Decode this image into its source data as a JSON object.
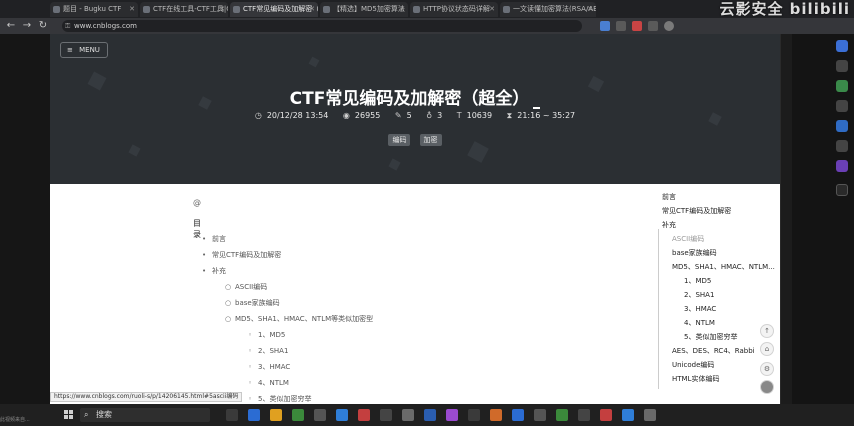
{
  "browser": {
    "tabs": [
      {
        "label": "题目 - Bugku CTF",
        "active": false
      },
      {
        "label": "CTF在线工具-CTF工具|CTF",
        "active": false
      },
      {
        "label": "CTF常见编码及加解密（超全",
        "active": true
      },
      {
        "label": "【精选】MD5加密算法",
        "active": false
      },
      {
        "label": "HTTP协议状态码详解",
        "active": false
      },
      {
        "label": "一文读懂加密算法(RSA/AES",
        "active": false
      }
    ],
    "url": "www.cnblogs.com",
    "watermark": "云影安全 bilibili"
  },
  "banner": {
    "menu_label": "MENU",
    "title": "CTF常见编码及加解密（超全）",
    "meta": {
      "date": "20/12/28 13:54",
      "views": "26955",
      "comments": "5",
      "likes": "3",
      "words": "10639",
      "read_time": "21:16 ~ 35:27"
    },
    "tags": [
      "编码",
      "加密"
    ]
  },
  "article_toc": {
    "hash_glyph": "@",
    "heading": "目录",
    "items": [
      {
        "level": 1,
        "bullet": "•",
        "label": "前言"
      },
      {
        "level": 1,
        "bullet": "•",
        "label": "常见CTF编码及加解密"
      },
      {
        "level": 1,
        "bullet": "•",
        "label": "补充"
      },
      {
        "level": 2,
        "bullet": "○",
        "label": "ASCII编码"
      },
      {
        "level": 2,
        "bullet": "○",
        "label": "base家族编码"
      },
      {
        "level": 2,
        "bullet": "○",
        "label": "MD5、SHA1、HMAC、NTLM等类似加密型"
      },
      {
        "level": 3,
        "bullet": "◦",
        "label": "1、MD5"
      },
      {
        "level": 3,
        "bullet": "◦",
        "label": "2、SHA1"
      },
      {
        "level": 3,
        "bullet": "◦",
        "label": "3、HMAC"
      },
      {
        "level": 3,
        "bullet": "◦",
        "label": "4、NTLM"
      },
      {
        "level": 3,
        "bullet": "◦",
        "label": "5、类似加密穷举"
      }
    ]
  },
  "side_toc": {
    "items": [
      {
        "label": "前言",
        "indent": 0,
        "muted": false
      },
      {
        "label": "常见CTF编码及加解密",
        "indent": 0,
        "muted": false
      },
      {
        "label": "补充",
        "indent": 0,
        "muted": false
      },
      {
        "label": "ASCII编码",
        "indent": 1,
        "muted": true
      },
      {
        "label": "base家族编码",
        "indent": 1,
        "muted": false
      },
      {
        "label": "MD5、SHA1、HMAC、NTLM...",
        "indent": 1,
        "muted": false
      },
      {
        "label": "1、MD5",
        "indent": 2,
        "muted": false
      },
      {
        "label": "2、SHA1",
        "indent": 2,
        "muted": false
      },
      {
        "label": "3、HMAC",
        "indent": 2,
        "muted": false
      },
      {
        "label": "4、NTLM",
        "indent": 2,
        "muted": false
      },
      {
        "label": "5、类似加密穷举",
        "indent": 2,
        "muted": false
      },
      {
        "label": "AES、DES、RC4、Rabbi",
        "indent": 1,
        "muted": false
      },
      {
        "label": "Unicode编码",
        "indent": 1,
        "muted": false
      },
      {
        "label": "HTML实体编码",
        "indent": 1,
        "muted": false
      }
    ]
  },
  "status_url": "https://www.cnblogs.com/ruoli-s/p/14206145.html#5ascii编码",
  "taskbar": {
    "search_label": "搜索",
    "clip_label": "此视频来自..."
  },
  "colors": {
    "banner_bg": "#2b2f33",
    "page_bg": "#ffffff",
    "taskbar_bg": "#202020"
  }
}
